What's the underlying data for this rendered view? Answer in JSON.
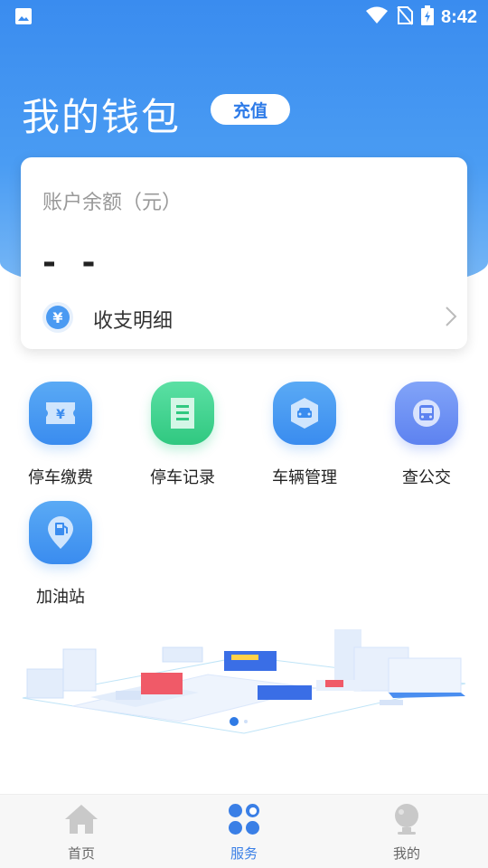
{
  "status_bar": {
    "time": "8:42"
  },
  "wallet": {
    "title": "我的钱包",
    "recharge_label": "充值",
    "balance_label": "账户余额（元）",
    "balance_value": "- -",
    "detail_label": "收支明细",
    "detail_icon_glyph": "¥"
  },
  "services": [
    {
      "label": "停车缴费",
      "icon": "parking-payment-icon",
      "color": "#4a9af2"
    },
    {
      "label": "停车记录",
      "icon": "parking-record-icon",
      "color": "#3ccf8e"
    },
    {
      "label": "车辆管理",
      "icon": "vehicle-management-icon",
      "color": "#4a9af2"
    },
    {
      "label": "查公交",
      "icon": "bus-query-icon",
      "color": "#6b8ef5"
    },
    {
      "label": "加油站",
      "icon": "gas-station-icon",
      "color": "#4a9af2"
    }
  ],
  "tabbar": {
    "items": [
      {
        "label": "首页",
        "icon": "home-icon",
        "active": false
      },
      {
        "label": "服务",
        "icon": "services-icon",
        "active": true
      },
      {
        "label": "我的",
        "icon": "profile-icon",
        "active": false
      }
    ],
    "active_color": "#3a7fe6",
    "inactive_color": "#666666"
  },
  "colors": {
    "accent": "#3a8cef",
    "green": "#3ccf8e"
  }
}
